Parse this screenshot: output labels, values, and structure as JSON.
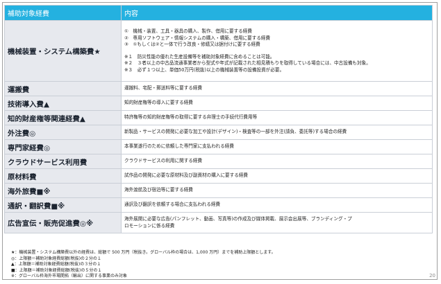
{
  "header": {
    "col1": "補助対象経費",
    "col2": "内容"
  },
  "rows": [
    {
      "category": "機械装置・システム構築費★",
      "lines": [
        "①　機械・装置、工具・器具の購入、製作、借用に要する経費",
        "②　専用ソフトウェア・情報システムの購入・構築、借用に要する経費",
        "③　①もしくは②と一体で行う改良・修繕又は据付けに要する経費"
      ],
      "notes": [
        "※１　防災性能の優れた生産設備等を補助対象経費に含めることは可能。",
        "※２　３者以上の中古品流通事業者から型式や年式が記載された相見積もりを取得している場合には、中古設備も対象。",
        "※３　必ず１つ以上、単価50万円(税抜)以上の機械装置等の設備投資が必要。"
      ]
    },
    {
      "category": "運搬費",
      "lines": [
        "運搬料、宅配・郵送料等に要する経費"
      ]
    },
    {
      "category": "技術導入費▲",
      "lines": [
        "知的財産権等の導入に要する経費"
      ]
    },
    {
      "category": "知的財産権等関連経費▲",
      "lines": [
        "特許権等の知的財産権等の取得に要する弁理士の手続代行費用等"
      ]
    },
    {
      "category": "外注費◎",
      "lines": [
        "新製品・サービスの開発に必要な加工や設計(デザイン)・検査等の一部を外注(請負、委託等)する場合の経費"
      ]
    },
    {
      "category": "専門家経費◎",
      "lines": [
        "本事業遂行のために依頼した専門家に支払われる経費"
      ]
    },
    {
      "category": "クラウドサービス利用費",
      "lines": [
        "クラウドサービスの利用に関する経費"
      ]
    },
    {
      "category": "原材料費",
      "lines": [
        "試作品の開発に必要な原材料及び副資材の購入に要する経費"
      ]
    },
    {
      "category": "海外旅費■※",
      "lines": [
        "海外渡航及び宿泊等に要する経費"
      ]
    },
    {
      "category": "通訳・翻訳費■※",
      "lines": [
        "通訳及び翻訳を依頼する場合に支払われる経費"
      ]
    },
    {
      "category": "広告宣伝・販売促進費◎※",
      "lines": [
        "海外展開に必要な広告(パンフレット、動画、写真等)の作成及び媒体掲載、展示会出展等、ブランディング・プ",
        "ロモーションに係る経費"
      ]
    }
  ],
  "footnotes": [
    "★：機械装置・システム構築費以外の経費は、総額で 500 万円（税抜き。グローバル枠の場合は、1,000 万円）までを補助上限額とします。",
    "◎：上限額＝補助対象経費総額(税抜)の２分の１",
    "▲：上限額＝補助対象経費総額(税抜)の３分の１",
    "■：上限額＝補助対象経費総額(税抜)の５分の１",
    "※：グローバル枠海外市場開拓（輸出）に関する事業のみ対象"
  ],
  "page_number": "20",
  "colors": {
    "header_bg": "#24b1e0",
    "category_bg": "#e7e9ee",
    "border": "#c9ced6"
  }
}
